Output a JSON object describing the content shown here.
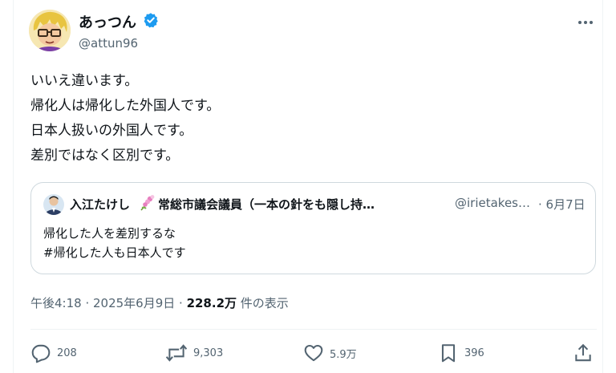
{
  "author": {
    "display_name": "あっつん",
    "handle": "@attun96"
  },
  "post": {
    "lines": [
      "いいえ違います。",
      "帰化人は帰化した外国人です。",
      "日本人扱いの外国人です。",
      "差別ではなく区別です。"
    ]
  },
  "quote": {
    "name": "入江たけし",
    "name_rest": "常総市議会議員（一本の針をも隠し持…",
    "handle": "@irietakes…",
    "date": "· 6月7日",
    "lines": [
      "帰化した人を差別するな",
      "#帰化した人も日本人です"
    ]
  },
  "meta": {
    "time": "午後4:18 · 2025年6月9日 · ",
    "views": "228.2万",
    "views_suffix": " 件の表示"
  },
  "actions": {
    "replies": "208",
    "reposts": "9,303",
    "likes": "5.9万",
    "bookmarks": "396"
  },
  "colors": {
    "verified": "#1d9bf0",
    "secondary_text": "#536471",
    "border": "#cfd9de"
  }
}
